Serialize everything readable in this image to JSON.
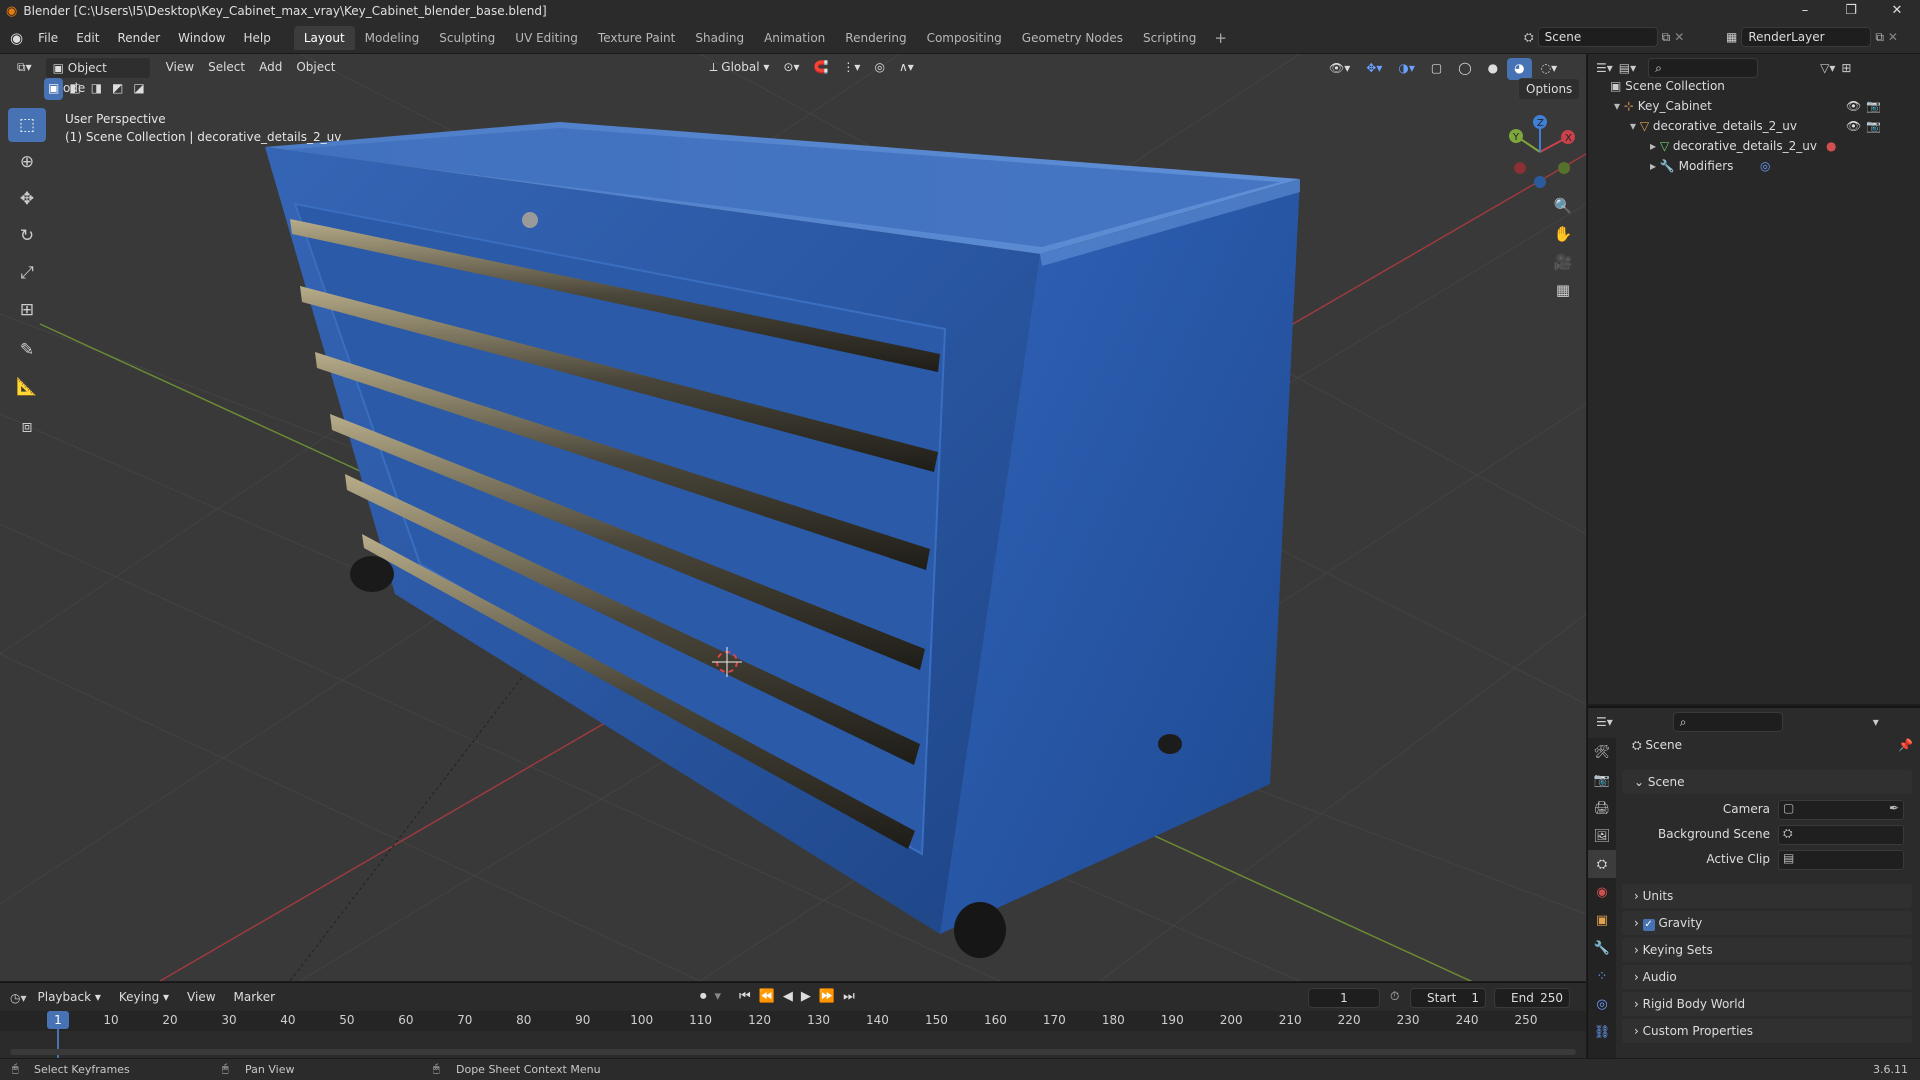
{
  "window": {
    "title": "Blender [C:\\Users\\I5\\Desktop\\Key_Cabinet_max_vray\\Key_Cabinet_blender_base.blend]",
    "controls": [
      "–",
      "❐",
      "✕"
    ]
  },
  "menubar": {
    "menus": [
      "File",
      "Edit",
      "Render",
      "Window",
      "Help"
    ],
    "workspaces": [
      "Layout",
      "Modeling",
      "Sculpting",
      "UV Editing",
      "Texture Paint",
      "Shading",
      "Animation",
      "Rendering",
      "Compositing",
      "Geometry Nodes",
      "Scripting"
    ],
    "active_workspace": "Layout",
    "add_label": "+",
    "scene_value": "Scene",
    "renderlayer_value": "RenderLayer"
  },
  "viewport_header": {
    "mode": "Object Mode",
    "menus": [
      "View",
      "Select",
      "Add",
      "Object"
    ],
    "transform_orientation": "Global",
    "options_label": "Options"
  },
  "viewport": {
    "perspective_label": "User Perspective",
    "collection_label": "(1) Scene Collection | decorative_details_2_uv",
    "gizmo_axes": [
      "X",
      "Y",
      "Z"
    ]
  },
  "toolbar": {
    "tools": [
      "select-box-icon",
      "cursor-icon",
      "move-icon",
      "rotate-icon",
      "scale-icon",
      "transform-icon",
      "annotate-icon",
      "measure-icon",
      "add-cube-icon"
    ]
  },
  "outliner": {
    "search_placeholder": "",
    "rows": [
      {
        "label": "Scene Collection",
        "indent": 0
      },
      {
        "label": "Key_Cabinet",
        "indent": 1
      },
      {
        "label": "decorative_details_2_uv",
        "indent": 2
      },
      {
        "label": "decorative_details_2_uv",
        "indent": 3
      },
      {
        "label": "Modifiers",
        "indent": 3
      }
    ]
  },
  "properties": {
    "header_title": "Scene",
    "section_scene": "Scene",
    "camera_label": "Camera",
    "background_scene_label": "Background Scene",
    "active_clip_label": "Active Clip",
    "collapsed_sections": [
      "Units",
      "Gravity",
      "Keying Sets",
      "Audio",
      "Rigid Body World",
      "Custom Properties"
    ],
    "gravity_checked": true
  },
  "timeline": {
    "menus": [
      "Playback",
      "Keying",
      "View",
      "Marker"
    ],
    "current_frame": "1",
    "start_label": "Start",
    "start_value": "1",
    "end_label": "End",
    "end_value": "250",
    "ruler": [
      "1",
      "10",
      "20",
      "30",
      "40",
      "50",
      "60",
      "70",
      "80",
      "90",
      "100",
      "110",
      "120",
      "130",
      "140",
      "150",
      "160",
      "170",
      "180",
      "190",
      "200",
      "210",
      "220",
      "230",
      "240",
      "250"
    ]
  },
  "statusbar": {
    "hints": [
      "Select Keyframes",
      "Pan View",
      "Dope Sheet Context Menu"
    ],
    "version": "3.6.11"
  },
  "colors": {
    "accent": "#4772b3",
    "cabinet_blue": "#2f5aa6",
    "x_axis": "#c8414b",
    "y_axis": "#7ea63a",
    "z_axis": "#3f7fd6"
  }
}
